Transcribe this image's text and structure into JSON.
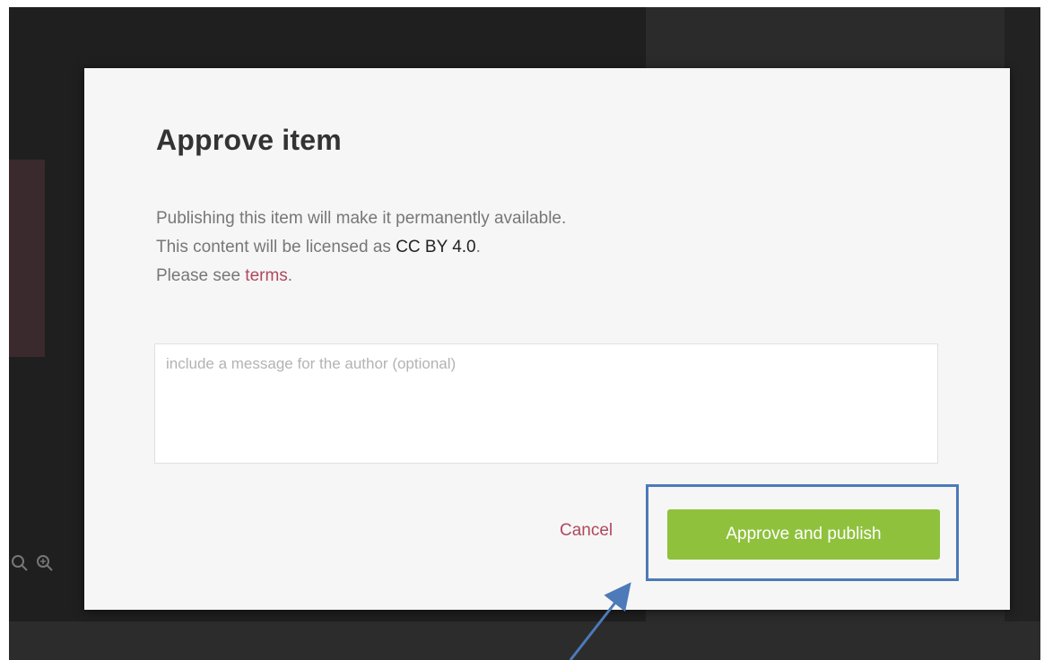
{
  "dialog": {
    "title": "Approve item",
    "line1": "Publishing this item will make it permanently available.",
    "line2_prefix": "This content will be licensed as ",
    "license": "CC BY 4.0",
    "line2_suffix": ".",
    "line3_prefix": "Please see ",
    "terms_link": "terms",
    "line3_suffix": ".",
    "message_placeholder": "include a message for the author (optional)",
    "message_value": "",
    "cancel_label": "Cancel",
    "approve_label": "Approve and publish"
  },
  "background_toolbar": {
    "icons": [
      "zoom-out-icon",
      "zoom-in-icon"
    ]
  },
  "colors": {
    "accent_green": "#8fc13d",
    "link_red": "#b0485d",
    "annotation_blue": "#4d7ab8",
    "backdrop": "#252525"
  }
}
